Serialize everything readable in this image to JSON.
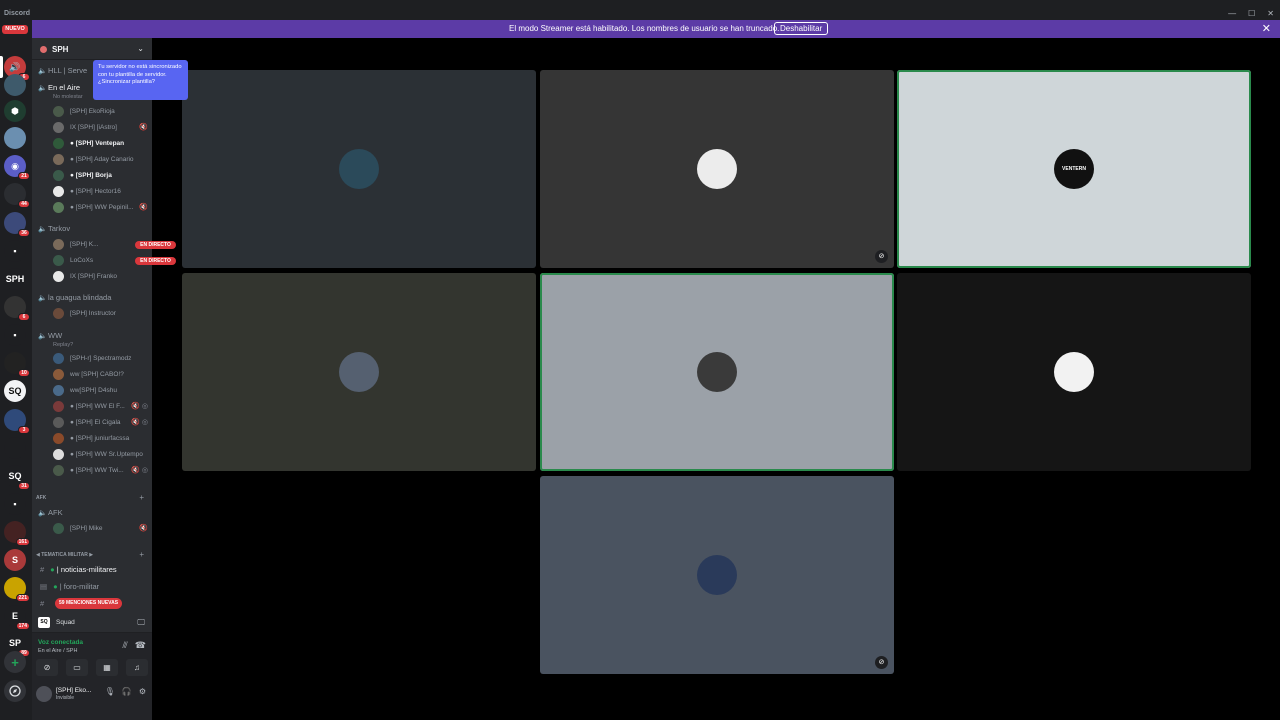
{
  "window": {
    "app_name": "Discord",
    "controls": [
      "—",
      "☐",
      "✕"
    ]
  },
  "banner": {
    "message": "El modo Streamer está habilitado. Los nombres de usuario se han truncado.",
    "disable_label": "Deshabilitar",
    "close_label": "✕",
    "color": "#5c3ba6"
  },
  "rail": {
    "nuevo_label": "NUEVO",
    "home_icon": "discord-logo-icon",
    "servers": [
      {
        "name": "server-audio",
        "initials": "🔊",
        "color": "#c43c3c",
        "badge": "6"
      },
      {
        "name": "server-soldier",
        "initials": "",
        "color": "#3e5a6b",
        "badge": ""
      },
      {
        "name": "server-cube",
        "initials": "⬢",
        "color": "#1f3d30",
        "badge": ""
      },
      {
        "name": "server-hat",
        "initials": "",
        "color": "#6b8fb0",
        "badge": ""
      },
      {
        "name": "server-gamepad",
        "initials": "◉",
        "color": "#5b5ec7",
        "badge": "21"
      },
      {
        "name": "server-compass",
        "initials": "",
        "color": "#2b2d31",
        "badge": "44"
      },
      {
        "name": "server-map",
        "initials": "",
        "color": "#3c4a7a",
        "badge": "36"
      },
      {
        "name": "folder-1",
        "initials": "▪",
        "color": "#1e1f22",
        "badge": ""
      },
      {
        "name": "server-sph",
        "initials": "SPH",
        "color": "#1e1f22",
        "badge": ""
      },
      {
        "name": "server-dark",
        "initials": "",
        "color": "#333",
        "badge": "6"
      },
      {
        "name": "folder-2",
        "initials": "▪",
        "color": "#1e1f22",
        "badge": ""
      },
      {
        "name": "server-wolf",
        "initials": "",
        "color": "#222",
        "badge": "10"
      },
      {
        "name": "server-recon",
        "initials": "SQ",
        "color": "#f2f3f5",
        "badge": ""
      },
      {
        "name": "server-grid",
        "initials": "",
        "color": "#2f4a7a",
        "badge": "3"
      },
      {
        "name": "server-helmet",
        "initials": "",
        "color": "#1e1f22",
        "badge": ""
      },
      {
        "name": "server-sq",
        "initials": "SQ",
        "color": "#1e1f22",
        "badge": "31"
      },
      {
        "name": "folder-3",
        "initials": "▪",
        "color": "#1e1f22",
        "badge": ""
      },
      {
        "name": "server-red",
        "initials": "",
        "color": "#442222",
        "badge": "161"
      },
      {
        "name": "server-s",
        "initials": "S",
        "color": "#aa3a3a",
        "badge": ""
      },
      {
        "name": "server-yellow",
        "initials": "",
        "color": "#c9a300",
        "badge": "221"
      },
      {
        "name": "server-e",
        "initials": "E",
        "color": "#1e1f22",
        "badge": "174"
      },
      {
        "name": "server-spi",
        "initials": "SP",
        "color": "#1e1f22",
        "badge": "89"
      }
    ],
    "add_label": "+",
    "discover_icon": "compass-icon"
  },
  "sidebar": {
    "server_name": "SPH",
    "tooltip": "Tu servidor no está sincronizado con tu plantilla de servidor. ¿Sincronizar plantilla?",
    "channels": {
      "hll": "HLL | Serve",
      "en_el_aire": "En el Aire",
      "en_el_aire_status": "No molestar",
      "tarkov": "Tarkov",
      "guagua": "la guagua blindada",
      "ww": "WW",
      "ww_status": "Replay?",
      "afk": "AFK"
    },
    "aire_members": [
      {
        "name": "[SPH] EkoRioja",
        "bright": false,
        "status": ""
      },
      {
        "name": "IX [SPH] [iAstro]",
        "bright": false,
        "status": "🔇"
      },
      {
        "name": "● [SPH] Ventepan",
        "bright": true,
        "status": ""
      },
      {
        "name": "● [SPH] Aday Canario",
        "bright": false,
        "status": ""
      },
      {
        "name": "● [SPH] Borja",
        "bright": true,
        "status": ""
      },
      {
        "name": "● [SPH] Hector16",
        "bright": false,
        "status": ""
      },
      {
        "name": "● [SPH] WW Pepinil...",
        "bright": false,
        "status": "🔇"
      }
    ],
    "tarkov_members": [
      {
        "name": "[SPH] K...",
        "live": "EN DIRECTO"
      },
      {
        "name": "LoCoXs",
        "live": "EN DIRECTO"
      },
      {
        "name": "IX [SPH] Franko",
        "live": ""
      }
    ],
    "guagua_members": [
      {
        "name": "[SPH] Instructor"
      }
    ],
    "ww_members": [
      {
        "name": "[SPH-r] Spectramodz",
        "status": ""
      },
      {
        "name": "ww [SPH] CABO!?",
        "status": ""
      },
      {
        "name": "ww[SPH] D4shu",
        "status": ""
      },
      {
        "name": "● [SPH] WW El F...",
        "status": "🔇 ◎"
      },
      {
        "name": "● [SPH] El Cigala",
        "status": "🔇 ◎"
      },
      {
        "name": "● [SPH] juniurfacssa",
        "status": ""
      },
      {
        "name": "● [SPH] WW Sr.Uptempo",
        "status": ""
      },
      {
        "name": "● [SPH] WW Twi...",
        "status": "🔇 ◎"
      }
    ],
    "afk_category": "AFK",
    "afk_members": [
      {
        "name": "[SPH] Mike",
        "status": "🔇"
      }
    ],
    "tematica_category": "◀ TEMATICA MILITAR ▶",
    "text_channels": [
      {
        "name": "| noticias-militares",
        "bright": true
      },
      {
        "name": "| foro-militar",
        "bright": false
      }
    ],
    "mentions": "59 MENCIONES NUEVAS",
    "activity": {
      "icon": "SQ",
      "label": "Squad"
    },
    "voice": {
      "status": "Voz conectada",
      "channel": "En el Aire / SPH"
    },
    "user": {
      "name": "[SPH] Eko...",
      "status": "Invisible"
    }
  },
  "tiles": [
    {
      "label": "avatar-soldier-badge",
      "bg": "#2b3035",
      "avatar_bg": "#2b4a5a",
      "muted": false,
      "speaking": false,
      "glyph": ""
    },
    {
      "label": "avatar-astronaut",
      "bg": "#353535",
      "avatar_bg": "#ececec",
      "muted": true,
      "speaking": false,
      "glyph": ""
    },
    {
      "label": "avatar-ventern",
      "bg": "#cfd6d9",
      "avatar_bg": "#111",
      "muted": false,
      "speaking": true,
      "glyph": "VENTERN"
    },
    {
      "label": "avatar-soldiers",
      "bg": "#33352f",
      "avatar_bg": "#556070",
      "muted": false,
      "speaking": false,
      "glyph": ""
    },
    {
      "label": "avatar-man-glasses",
      "bg": "#9ba1a8",
      "avatar_bg": "#3a3a3a",
      "muted": false,
      "speaking": true,
      "glyph": ""
    },
    {
      "label": "avatar-wolf-skull",
      "bg": "#151515",
      "avatar_bg": "#f2f2f2",
      "muted": false,
      "speaking": false,
      "glyph": ""
    },
    {
      "label": "avatar-pickle",
      "bg": "#4a5360",
      "avatar_bg": "#2a3a5a",
      "muted": true,
      "speaking": false,
      "glyph": ""
    }
  ]
}
